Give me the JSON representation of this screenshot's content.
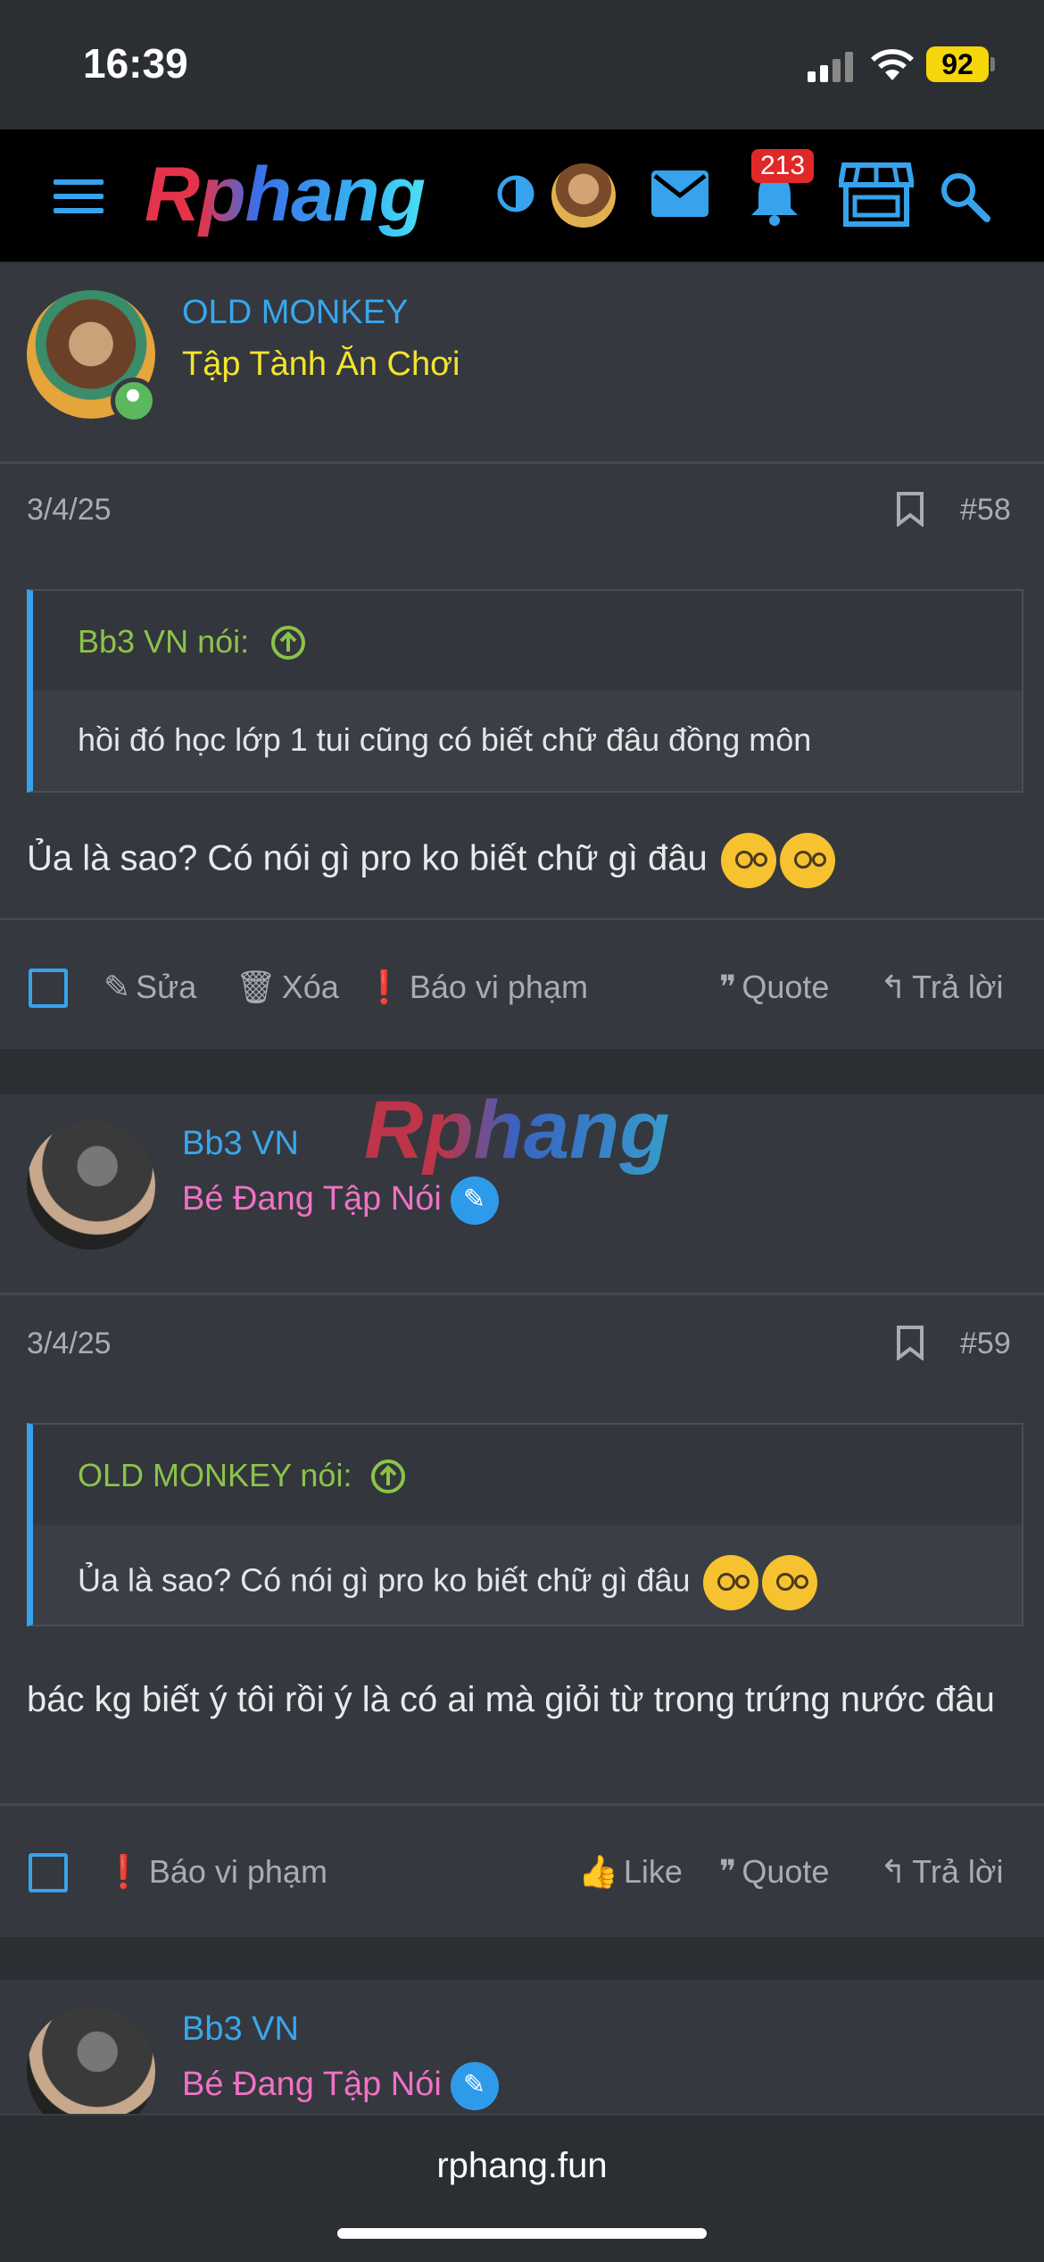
{
  "status": {
    "time": "16:39",
    "battery": "92"
  },
  "header": {
    "logo": "Rphang",
    "notifications": "213"
  },
  "posts": [
    {
      "username": "OLD MONKEY",
      "user_title": "Tập Tành Ăn Chơi",
      "date": "3/4/25",
      "number": "#58",
      "quote_author": "Bb3 VN nói:",
      "quote_text": "hồi đó học lớp 1 tui cũng có biết chữ đâu đồng môn",
      "message": "Ủa là sao? Có nói gì pro ko biết chữ gì đâu",
      "actions": {
        "edit": "Sửa",
        "delete": "Xóa",
        "report": "Báo vi phạm",
        "quote": "Quote",
        "reply": "Trả lời"
      }
    },
    {
      "username": "Bb3 VN",
      "user_title": "Bé Đang Tập Nói",
      "date": "3/4/25",
      "number": "#59",
      "quote_author": "OLD MONKEY nói:",
      "quote_text": "Ủa là sao? Có nói gì pro ko biết chữ gì đâu",
      "message": "bác kg biết ý tôi rồi ý là có ai mà giỏi từ trong trứng nước đâu",
      "actions": {
        "report": "Báo vi phạm",
        "like": "Like",
        "quote": "Quote",
        "reply": "Trả lời"
      }
    },
    {
      "username": "Bb3 VN",
      "user_title": "Bé Đang Tập Nói"
    }
  ],
  "watermark": "Rphang",
  "browser": {
    "url": "rphang.fun"
  }
}
